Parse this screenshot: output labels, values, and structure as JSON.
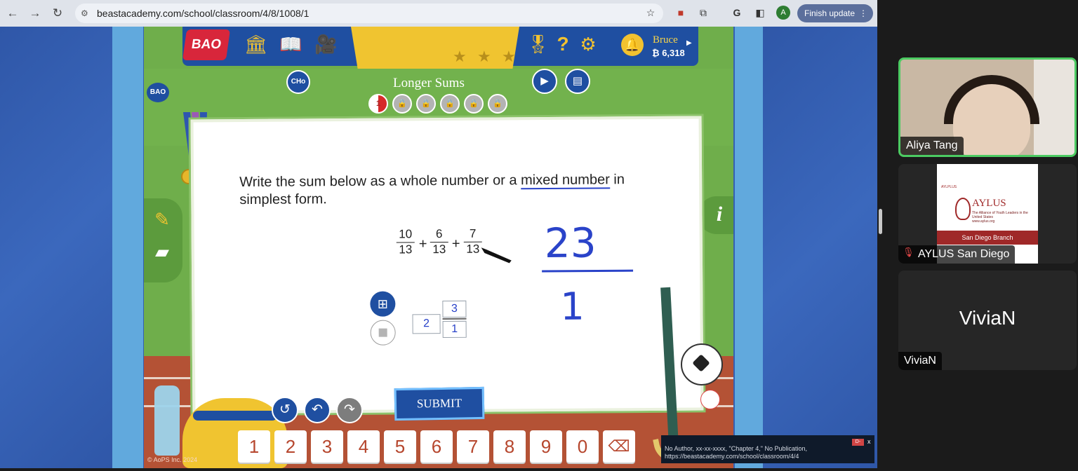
{
  "browser": {
    "url": "beastacademy.com/school/classroom/4/8/1008/1",
    "finish_update": "Finish update",
    "profile_initial": "A",
    "icons": [
      "back-icon",
      "forward-icon",
      "reload-icon",
      "site-info-icon",
      "bookmark-star-icon",
      "extension-icon",
      "puzzle-icon",
      "google-icon",
      "sidepanel-icon",
      "profile-icon",
      "kebab-menu-icon"
    ]
  },
  "game": {
    "logo": "BAO",
    "side_logo": "BAO",
    "user": {
      "name": "Bruce",
      "coins": "₿ 6,318"
    },
    "chapter_badge": "CHo",
    "lesson_title": "Longer Sums",
    "progress_dot_current": "1",
    "stars_total": 3,
    "problem": {
      "prompt_before": "Write the sum below as a whole number or a ",
      "prompt_link": "mixed number",
      "prompt_after": " in simplest form.",
      "fractions": [
        {
          "num": "10",
          "den": "13"
        },
        {
          "num": "6",
          "den": "13"
        },
        {
          "num": "7",
          "den": "13"
        }
      ],
      "plus": "+",
      "handwritten_num": "23",
      "handwritten_den": "1",
      "answer": {
        "whole": "2",
        "numerator": "3",
        "denominator": "1"
      }
    },
    "submit_label": "SUBMIT",
    "keypad": [
      "1",
      "2",
      "3",
      "4",
      "5",
      "6",
      "7",
      "8",
      "9",
      "0",
      "⌫"
    ],
    "copyright": "© AoPS Inc. 2024",
    "colors": {
      "blue": "#1f4fa1",
      "yellow": "#f0c430",
      "red": "#d8263b",
      "track": "#b45235",
      "grass": "#6fae4b"
    }
  },
  "citation": {
    "text": "No Author, xx-xx-xxxx, \"Chapter 4,\" No Publication, https://beastacademy.com/school/classroom/4/4",
    "grade": "D-",
    "close": "x"
  },
  "call": {
    "participants": [
      {
        "name": "Aliya Tang",
        "active_speaker": true
      },
      {
        "name": "AYLUS San Diego",
        "muted": true
      },
      {
        "name": "ViviaN"
      }
    ],
    "aylus_card": {
      "small": "AYLPLUS",
      "headline": "AYLUS",
      "subline": "The Alliance of Youth Leaders in the United States",
      "url": "www.aylus.org",
      "branch": "San Diego Branch"
    },
    "vivian_display": "ViviaN"
  }
}
